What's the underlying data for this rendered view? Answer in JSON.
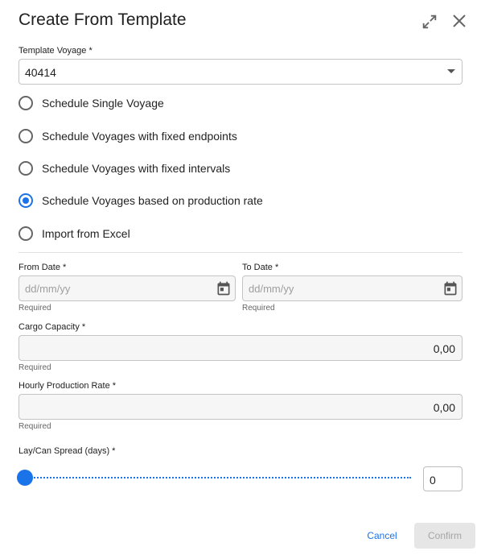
{
  "dialog": {
    "title": "Create From Template"
  },
  "template_voyage": {
    "label": "Template Voyage *",
    "value": "40414"
  },
  "schedule_options": [
    {
      "label": "Schedule Single Voyage",
      "checked": false
    },
    {
      "label": "Schedule Voyages with fixed endpoints",
      "checked": false
    },
    {
      "label": "Schedule Voyages with fixed intervals",
      "checked": false
    },
    {
      "label": "Schedule Voyages based on production rate",
      "checked": true
    },
    {
      "label": "Import from Excel",
      "checked": false
    }
  ],
  "from_date": {
    "label": "From Date *",
    "placeholder": "dd/mm/yy",
    "helper": "Required"
  },
  "to_date": {
    "label": "To Date *",
    "placeholder": "dd/mm/yy",
    "helper": "Required"
  },
  "cargo_capacity": {
    "label": "Cargo Capacity *",
    "value": "0,00",
    "helper": "Required"
  },
  "hourly_production_rate": {
    "label": "Hourly Production Rate *",
    "value": "0,00",
    "helper": "Required"
  },
  "lay_can_spread": {
    "label": "Lay/Can Spread (days) *",
    "value": "0"
  },
  "actions": {
    "cancel_label": "Cancel",
    "confirm_label": "Confirm"
  },
  "colors": {
    "accent": "#1a73e8",
    "disabled_bg": "#e6e6e6",
    "disabled_text": "#a5a5a5"
  }
}
